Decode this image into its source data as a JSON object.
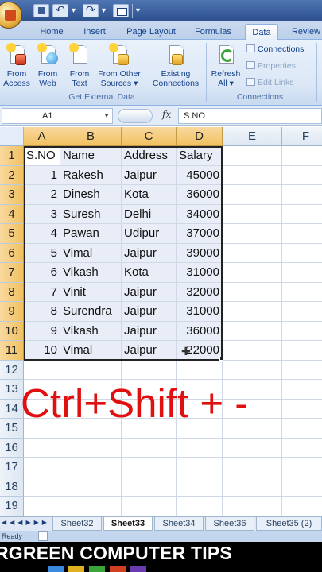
{
  "ribbon": {
    "tabs": [
      "Home",
      "Insert",
      "Page Layout",
      "Formulas",
      "Data",
      "Review"
    ],
    "active_tab": "Data",
    "buttons": {
      "from_access": [
        "From",
        "Access"
      ],
      "from_web": [
        "From",
        "Web"
      ],
      "from_text": [
        "From",
        "Text"
      ],
      "from_other": [
        "From Other",
        "Sources ▾"
      ],
      "existing": [
        "Existing",
        "Connections"
      ],
      "refresh": [
        "Refresh",
        "All ▾"
      ]
    },
    "group_get_external": "Get External Data",
    "group_connections": "Connections",
    "connections_items": [
      "Connections",
      "Properties",
      "Edit Links"
    ]
  },
  "formula_bar": {
    "name_box": "A1",
    "fx": "fx",
    "formula": "S.NO"
  },
  "columns": [
    "A",
    "B",
    "C",
    "D",
    "E",
    "F"
  ],
  "rows": [
    "1",
    "2",
    "3",
    "4",
    "5",
    "6",
    "7",
    "8",
    "9",
    "10",
    "11",
    "12",
    "13",
    "14",
    "15",
    "16",
    "17",
    "18",
    "19"
  ],
  "table": {
    "headers": [
      "S.NO",
      "Name",
      "Address",
      "Salary"
    ],
    "rows": [
      [
        "1",
        "Rakesh",
        "Jaipur",
        "45000"
      ],
      [
        "2",
        "Dinesh",
        "Kota",
        "36000"
      ],
      [
        "3",
        "Suresh",
        "Delhi",
        "34000"
      ],
      [
        "4",
        "Pawan",
        "Udipur",
        "37000"
      ],
      [
        "5",
        "Vimal",
        "Jaipur",
        "39000"
      ],
      [
        "6",
        "Vikash",
        "Kota",
        "31000"
      ],
      [
        "7",
        "Vinit",
        "Jaipur",
        "32000"
      ],
      [
        "8",
        "Surendra",
        "Jaipur",
        "31000"
      ],
      [
        "9",
        "Vikash",
        "Jaipur",
        "36000"
      ],
      [
        "10",
        "Vimal",
        "Jaipur",
        "22000"
      ]
    ]
  },
  "overlay_text": "Ctrl+Shift + -",
  "sheet_tabs": [
    "Sheet32",
    "Sheet33",
    "Sheet34",
    "Sheet36",
    "Sheet35 (2)"
  ],
  "active_sheet": "Sheet33",
  "status": "Ready",
  "banner": "RGREEN COMPUTER TIPS",
  "colors": {
    "overlay": "#e01010",
    "selection_header": "#f1c15f",
    "ribbon_text": "#15428b"
  }
}
